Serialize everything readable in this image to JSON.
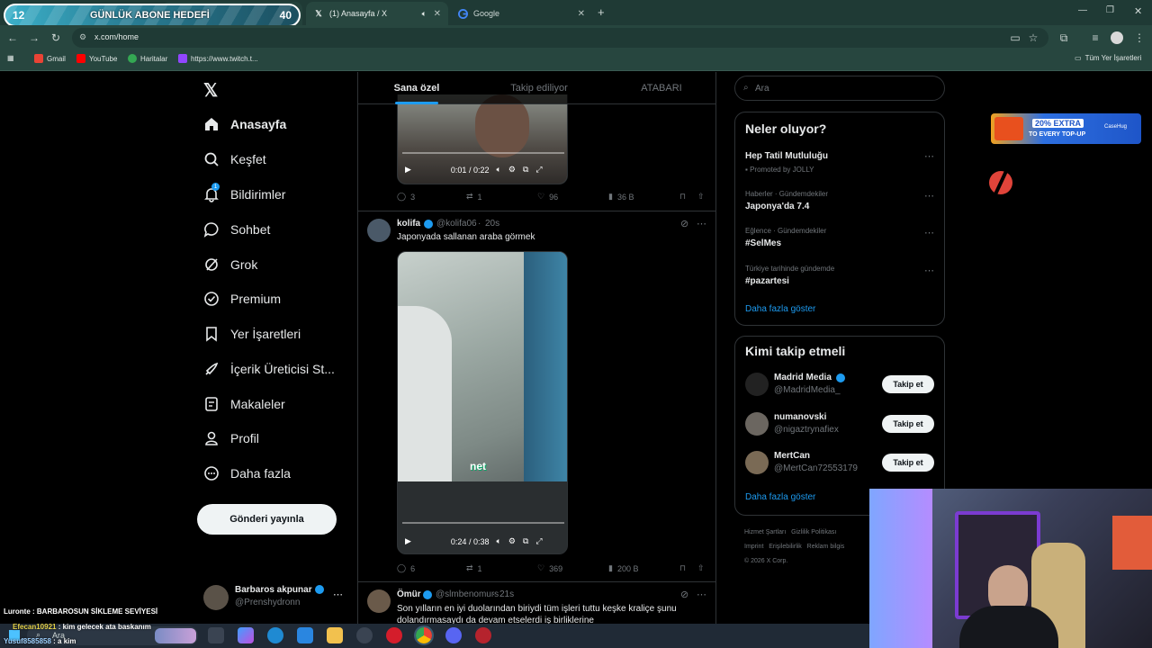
{
  "overlay": {
    "goal_left": "12",
    "goal_title": "GÜNLÜK ABONE HEDEFİ",
    "goal_right": "40"
  },
  "browser": {
    "tabs": [
      {
        "title": "(1) Anasayfa / X",
        "icon": "x-logo"
      },
      {
        "title": "Google",
        "icon": "google-logo"
      }
    ],
    "behind_tab_fragment": "/ X",
    "url": "x.com/home",
    "bookmarks": [
      {
        "label": "Gmail",
        "color": "#ea4335"
      },
      {
        "label": "YouTube",
        "color": "#ff0000"
      },
      {
        "label": "Haritalar",
        "color": "#34a853"
      },
      {
        "label": "https://www.twitch.t...",
        "color": "#9146ff"
      }
    ],
    "all_bookmarks": "Tüm Yer İşaretleri"
  },
  "nav": {
    "items": [
      {
        "label": "Anasayfa",
        "icon": "home-icon"
      },
      {
        "label": "Keşfet",
        "icon": "search-icon"
      },
      {
        "label": "Bildirimler",
        "icon": "bell-icon",
        "badge": "1"
      },
      {
        "label": "Sohbet",
        "icon": "chat-icon"
      },
      {
        "label": "Grok",
        "icon": "grok-icon"
      },
      {
        "label": "Premium",
        "icon": "premium-icon"
      },
      {
        "label": "Yer İşaretleri",
        "icon": "bookmark-icon"
      },
      {
        "label": "İçerik Üreticisi St...",
        "icon": "rocket-icon"
      },
      {
        "label": "Makaleler",
        "icon": "article-icon"
      },
      {
        "label": "Profil",
        "icon": "profile-icon"
      },
      {
        "label": "Daha fazla",
        "icon": "more-icon"
      }
    ],
    "post_button": "Gönderi yayınla",
    "account": {
      "name": "Barbaros akpunar",
      "handle": "@Prenshydronn"
    }
  },
  "feed": {
    "tabs": [
      "Sana özel",
      "Takip ediliyor",
      "ATABARI"
    ],
    "post1": {
      "video_time": "0:01 / 0:22",
      "replies": "3",
      "reposts": "1",
      "likes": "96",
      "views": "36 B"
    },
    "post2": {
      "name": "kolifa",
      "handle": "@kolifa06",
      "time": "20s",
      "text": "Japonyada sallanan araba görmek",
      "video_caption": "net",
      "video_time": "0:24 / 0:38",
      "replies": "6",
      "reposts": "1",
      "likes": "369",
      "views": "200 B"
    },
    "post3": {
      "name": "Ömür",
      "handle": "@slmbenomurs",
      "time": "21s",
      "text": "Son yılların en iyi duolarından biriydi tüm işleri tuttu keşke kraliçe şunu dolandırmasaydı da devam etselerdi iş birliklerine"
    }
  },
  "sidebar": {
    "search_placeholder": "Ara",
    "trends_title": "Neler oluyor?",
    "trends": [
      {
        "meta": "",
        "title": "Hep Tatil Mutluluğu",
        "promoted": "Promoted by JOLLY"
      },
      {
        "meta": "Haberler · Gündemdekiler",
        "title": "Japonya'da 7.4"
      },
      {
        "meta": "Eğlence · Gündemdekiler",
        "title": "#SelMes"
      },
      {
        "meta": "Türkiye tarihinde gündemde",
        "title": "#pazartesi"
      }
    ],
    "show_more": "Daha fazla göster",
    "who_to_follow_title": "Kimi takip etmeli",
    "follow": [
      {
        "name": "Madrid Media",
        "handle": "@MadridMedia_",
        "verified": true,
        "button": "Takip et"
      },
      {
        "name": "numanovski",
        "handle": "@nigaztrynafiex",
        "verified": false,
        "button": "Takip et"
      },
      {
        "name": "MertCan",
        "handle": "@MertCan72553179",
        "verified": false,
        "button": "Takip et"
      }
    ],
    "follow_more": "Daha fazla göster",
    "footer": [
      "Hizmet Şartları",
      "Gizlilik Politikası",
      "Imprint",
      "Erişilebilirlik",
      "Reklam bilgis",
      "© 2026 X Corp."
    ]
  },
  "ad": {
    "line1": "20% EXTRA",
    "line2": "TO EVERY TOP-UP",
    "brand": "CaseHug"
  },
  "chat": [
    {
      "user": "Luronte",
      "msg": "BARBAROSUN SİKLEME SEVİYESİ"
    },
    {
      "user": "Efecan10921",
      "msg": "kim gelecek ata baskanım"
    },
    {
      "user": "Yusuf8585858",
      "msg": "a kim"
    }
  ],
  "taskbar": {
    "search": "Ara"
  },
  "colors": {
    "accent": "#1d9bf0",
    "bg": "#000000",
    "border": "#2f3336",
    "muted": "#71767b"
  }
}
